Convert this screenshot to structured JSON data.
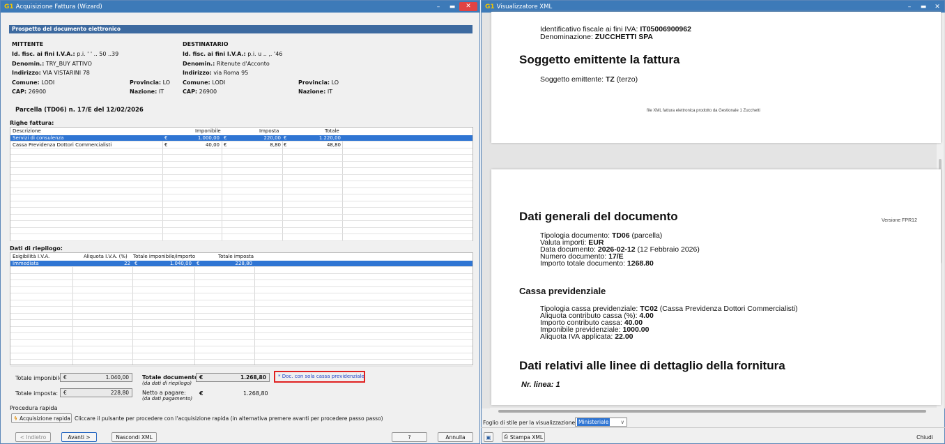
{
  "w1": {
    "title": "Acquisizione Fattura (Wizard)",
    "logo": "G1",
    "band": "Prospetto del documento elettronico",
    "mittente": {
      "head": "MITTENTE",
      "idlab": "Id. fisc. ai fini I.V.A.:",
      "idval": "p.i. ' ' .. 50 ..39",
      "denlab": "Denomin.:",
      "denval": "TRY_BUY ATTIVO",
      "indlab": "Indirizzo:",
      "indval": "VIA VISTARINI 78",
      "comlab": "Comune:",
      "comval": "LODI",
      "provlab": "Provincia:",
      "provval": "LO",
      "caplab": "CAP:",
      "capval": "26900",
      "nazlab": "Nazione:",
      "nazval": "IT"
    },
    "dest": {
      "head": "DESTINATARIO",
      "idlab": "Id. fisc. ai fini I.V.A.:",
      "idval": "p.i. u .. ,. '46",
      "denlab": "Denomin.:",
      "denval": "Ritenute d'Acconto",
      "indlab": "Indirizzo:",
      "indval": "via Roma 95",
      "comlab": "Comune:",
      "comval": "LODI",
      "provlab": "Provincia:",
      "provval": "LO",
      "caplab": "CAP:",
      "capval": "26900",
      "nazlab": "Nazione:",
      "nazval": "IT"
    },
    "parcella": "Parcella (TD06) n. 17/E del 12/02/2026",
    "righe": {
      "label": "Righe fattura:",
      "cols": [
        "Descrizione",
        "Imponibile",
        "Imposta",
        "Totale"
      ],
      "rows": [
        [
          "Servizi di consulenza",
          "€",
          "1.000,00",
          "€",
          "220,00",
          "€",
          "1.220,00"
        ],
        [
          "Cassa Previdenza Dottori Commercialisti",
          "€",
          "40,00",
          "€",
          "8,80",
          "€",
          "48,80"
        ]
      ]
    },
    "riep": {
      "label": "Dati di riepilogo:",
      "cols": [
        "Esigibilità I.V.A.",
        "Aliquota I.V.A. (%)",
        "Totale imponibile/importo",
        "Totale imposta"
      ],
      "rows": [
        [
          "Immediata",
          "22",
          "€",
          "1.040,00",
          "€",
          "228,80"
        ]
      ]
    },
    "tot": {
      "impLab": "Totale imponibile:",
      "impCur": "€",
      "impVal": "1.040,00",
      "impostaLab": "Totale imposta:",
      "impostaCur": "€",
      "impostaVal": "228,80",
      "docLab": "Totale documento:",
      "docSub": "(da dati di riepilogo)",
      "docCur": "€",
      "docVal": "1.268,80",
      "nettoLab": "Netto a pagare:",
      "nettoSub": "(da dati pagamento)",
      "nettoCur": "€",
      "nettoVal": "1.268,80",
      "note": "* Doc. con sola cassa previdenziale"
    },
    "proc": {
      "label": "Procedura rapida",
      "btn": "Acquisizione rapida",
      "hint": "Cliccare il pulsante per procedere con l'acquisizione rapida (in alternativa premere avanti per procedere passo passo)"
    },
    "buttons": {
      "back": "< Indietro",
      "next": "Avanti >",
      "hide": "Nascondi XML",
      "help": "?",
      "cancel": "Annulla"
    }
  },
  "w2": {
    "title": "Visualizzatore XML",
    "logo": "G1",
    "p1": {
      "l1a": "Identificativo fiscale ai fini IVA: ",
      "l1b": "IT05006900962",
      "l2a": "Denominazione: ",
      "l2b": "ZUCCHETTI SPA",
      "h": "Soggetto emittente la fattura",
      "l3a": "Soggetto emittente: ",
      "l3b": "TZ",
      "l3c": " (terzo)",
      "foot": "file XML fattura elettronica prodotto da Gestionale 1 Zucchetti"
    },
    "p2": {
      "ver": "Versione FPR12",
      "h1": "Dati generali del documento",
      "g": [
        [
          "Tipologia documento: ",
          "TD06",
          " (parcella)"
        ],
        [
          "Valuta importi: ",
          "EUR",
          ""
        ],
        [
          "Data documento: ",
          "2026-02-12",
          " (12 Febbraio 2026)"
        ],
        [
          "Numero documento: ",
          "17/E",
          ""
        ],
        [
          "Importo totale documento: ",
          "1268.80",
          ""
        ]
      ],
      "h2": "Cassa previdenziale",
      "c": [
        [
          "Tipologia cassa previdenziale: ",
          "TC02",
          " (Cassa Previdenza Dottori Commercialisti)"
        ],
        [
          "Aliquota contributo cassa (%): ",
          "4.00",
          ""
        ],
        [
          "Importo contributo cassa: ",
          "40.00",
          ""
        ],
        [
          "Imponibile previdenziale: ",
          "1000.00",
          ""
        ],
        [
          "Aliquota IVA applicata: ",
          "22.00",
          ""
        ]
      ],
      "h3": "Dati relativi alle linee di dettaglio della fornitura",
      "h4": "Nr. linea: 1"
    },
    "style": {
      "label": "Foglio di stile per la visualizzazione:",
      "value": "Ministeriale"
    },
    "buttons": {
      "print": "Stampa XML",
      "close": "Chiudi"
    }
  }
}
